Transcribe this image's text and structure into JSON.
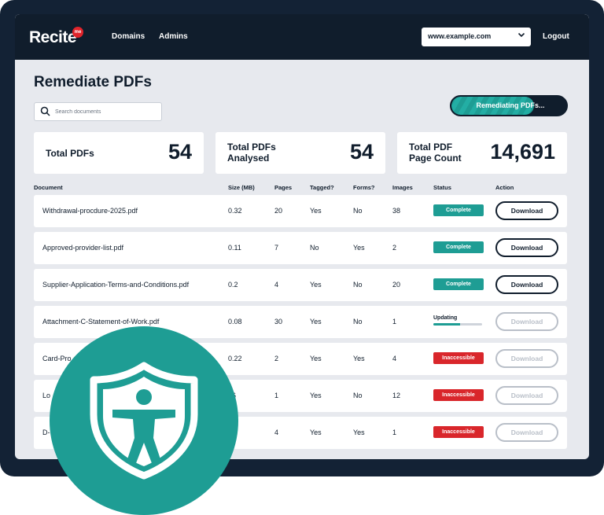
{
  "app": {
    "logo_text": "Recite",
    "logo_badge": "me",
    "nav": [
      "Domains",
      "Admins"
    ],
    "domain_select": "www.example.com",
    "logout": "Logout"
  },
  "page": {
    "title": "Remediate PDFs",
    "search_placeholder": "Search documents",
    "progress": {
      "label": "Remediating PDFs...",
      "fraction": 0.72
    }
  },
  "stats": [
    {
      "label": "Total PDFs",
      "value": "54"
    },
    {
      "label_lines": [
        "Total PDFs",
        "Analysed"
      ],
      "value": "54"
    },
    {
      "label_lines": [
        "Total PDF",
        "Page Count"
      ],
      "value": "14,691"
    }
  ],
  "table": {
    "headers": [
      "Document",
      "Size (MB)",
      "Pages",
      "Tagged?",
      "Forms?",
      "Images",
      "Status",
      "Action"
    ],
    "rows": [
      {
        "document": "Withdrawal-procdure-2025.pdf",
        "size": "0.32",
        "pages": "20",
        "tagged": "Yes",
        "forms": "No",
        "images": "38",
        "status": "Complete",
        "action": "Download",
        "action_enabled": true
      },
      {
        "document": "Approved-provider-list.pdf",
        "size": "0.11",
        "pages": "7",
        "tagged": "No",
        "forms": "Yes",
        "images": "2",
        "status": "Complete",
        "action": "Download",
        "action_enabled": true
      },
      {
        "document": "Supplier-Application-Terms-and-Conditions.pdf",
        "size": "0.2",
        "pages": "4",
        "tagged": "Yes",
        "forms": "No",
        "images": "20",
        "status": "Complete",
        "action": "Download",
        "action_enabled": true
      },
      {
        "document": "Attachment-C-Statement-of-Work.pdf",
        "size": "0.08",
        "pages": "30",
        "tagged": "Yes",
        "forms": "No",
        "images": "1",
        "status": "Updating",
        "status_progress": 0.55,
        "action": "Download",
        "action_enabled": false
      },
      {
        "document": "Card-Pro",
        "size": "0.22",
        "pages": "2",
        "tagged": "Yes",
        "forms": "Yes",
        "images": "4",
        "status": "Inaccessible",
        "action": "Download",
        "action_enabled": false
      },
      {
        "document": "Lo",
        "size": "16",
        "pages": "1",
        "tagged": "Yes",
        "forms": "No",
        "images": "12",
        "status": "Inaccessible",
        "action": "Download",
        "action_enabled": false
      },
      {
        "document": "D-",
        "size": "5",
        "pages": "4",
        "tagged": "Yes",
        "forms": "Yes",
        "images": "1",
        "status": "Inaccessible",
        "action": "Download",
        "action_enabled": false
      }
    ]
  },
  "colors": {
    "navy": "#101d2c",
    "teal": "#1e9d94",
    "red": "#d9262b",
    "background": "#e7e9ee"
  },
  "icons": [
    "search-icon",
    "chevron-down-icon",
    "accessibility-shield-icon"
  ]
}
